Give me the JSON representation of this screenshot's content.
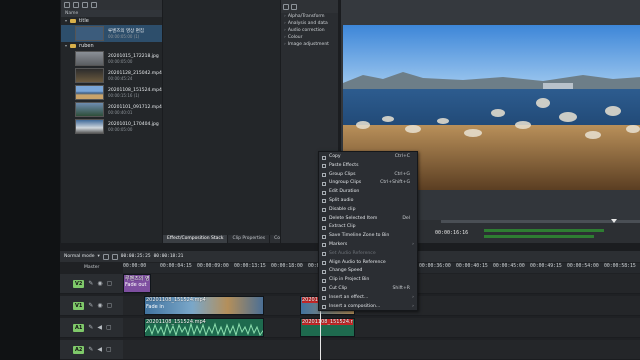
{
  "bin": {
    "header": "Name",
    "folders": [
      {
        "name": "title",
        "clips": [
          {
            "name": "루벤즈의 영상 편집",
            "duration": "00:00:05:00 (1)"
          }
        ]
      },
      {
        "name": "ruben",
        "clips": [
          {
            "name": "20201015_172218.jpg",
            "duration": "00:00:05:00"
          },
          {
            "name": "20201128_215042.mp4",
            "duration": "00:00:45:24"
          },
          {
            "name": "20201108_151524.mp4",
            "duration": "00:00:15:16 (1)"
          },
          {
            "name": "20201101_091712.mp4",
            "duration": "00:00:40:01"
          },
          {
            "name": "20201010_170404.jpg",
            "duration": "00:00:05:00"
          }
        ]
      }
    ]
  },
  "effects": {
    "items": [
      "Alpha/Transform",
      "Analysis and data",
      "Audio correction",
      "Colour",
      "Image adjustment"
    ],
    "tabs": [
      "Effect/Composition Stack",
      "Clip Properties",
      "Compositio..."
    ]
  },
  "monitor": {
    "timecode": "00:00:16:16"
  },
  "timeline": {
    "mode": "Normal mode",
    "position": "00:00:25:25",
    "duration": "00:00:18:21",
    "master_label": "Master",
    "ruler": [
      "00:00:00",
      "00:00:04:15",
      "00:00:09:00",
      "00:00:13:15",
      "00:00:18:00",
      "00:00:22:15",
      "00:00:27:00",
      "00:00:31:15",
      "00:00:36:00",
      "00:00:40:15",
      "00:00:45:00",
      "00:00:49:15",
      "00:00:54:00",
      "00:00:58:15"
    ],
    "tracks": [
      {
        "name": "V2",
        "color": "#7fc96a"
      },
      {
        "name": "V1",
        "color": "#7fc96a"
      },
      {
        "name": "A1",
        "color": "#7fc96a"
      },
      {
        "name": "A2",
        "color": "#7fc96a"
      }
    ],
    "clips": {
      "title_clip": "루벤즈의 영",
      "title_fade": "Fade out",
      "v1_clip_a": "20201108_151524.mp4",
      "v1_fade": "Fade in",
      "v1_clip_b": "20201",
      "a1_clip_a": "20201108_151524.mp4",
      "a1_clip_b": "20201108_151524.r"
    }
  },
  "context_menu": {
    "items": [
      {
        "label": "Copy",
        "shortcut": "Ctrl+C",
        "disabled": false
      },
      {
        "label": "Paste Effects",
        "shortcut": "",
        "disabled": false
      },
      {
        "label": "Group Clips",
        "shortcut": "Ctrl+G",
        "disabled": false
      },
      {
        "label": "Ungroup Clips",
        "shortcut": "Ctrl+Shift+G",
        "disabled": false
      },
      {
        "label": "Edit Duration",
        "shortcut": "",
        "disabled": false
      },
      {
        "label": "Split audio",
        "shortcut": "",
        "disabled": false
      },
      {
        "label": "Disable clip",
        "shortcut": "",
        "disabled": false
      },
      {
        "label": "Delete Selected Item",
        "shortcut": "Del",
        "disabled": false
      },
      {
        "label": "Extract Clip",
        "shortcut": "",
        "disabled": false
      },
      {
        "label": "Save Timeline Zone to Bin",
        "shortcut": "",
        "disabled": false
      },
      {
        "label": "Markers",
        "shortcut": "",
        "disabled": false,
        "submenu": true
      },
      {
        "label": "Set Audio Reference",
        "shortcut": "",
        "disabled": true
      },
      {
        "label": "Align Audio to Reference",
        "shortcut": "",
        "disabled": false
      },
      {
        "label": "Change Speed",
        "shortcut": "",
        "disabled": false
      },
      {
        "label": "Clip in Project Bin",
        "shortcut": "",
        "disabled": false
      },
      {
        "label": "Cut Clip",
        "shortcut": "Shift+R",
        "disabled": false
      },
      {
        "label": "Insert an effect...",
        "shortcut": "",
        "disabled": false,
        "submenu": true
      },
      {
        "label": "Insert a composition...",
        "shortcut": "",
        "disabled": false,
        "submenu": true
      }
    ]
  }
}
